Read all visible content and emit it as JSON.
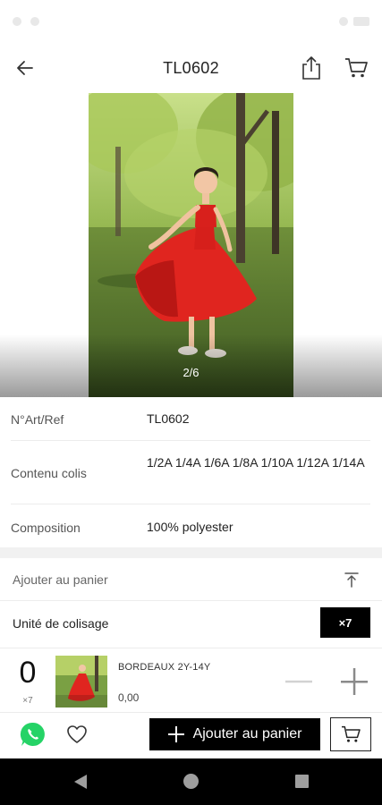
{
  "header": {
    "title": "TL0602"
  },
  "gallery": {
    "counter": "2/6"
  },
  "details": [
    {
      "label": "N°Art/Ref",
      "value": "TL0602"
    },
    {
      "label": "Contenu colis",
      "value": "1/2A 1/4A 1/6A 1/8A 1/10A 1/12A 1/14A"
    },
    {
      "label": "Composition",
      "value": "100% polyester"
    }
  ],
  "add_section": {
    "label": "Ajouter au panier"
  },
  "packing": {
    "label": "Unité de colisage",
    "badge": "×7"
  },
  "variant": {
    "quantity": "0",
    "multiplier": "×7",
    "name": "BORDEAUX 2Y-14Y",
    "price": "0,00"
  },
  "bottom_bar": {
    "add_to_cart_label": "Ajouter au panier"
  },
  "colors": {
    "accent": "#000000",
    "whatsapp": "#25D366",
    "dress_red": "#d8201c"
  },
  "icons": {
    "back": "arrow-left-icon",
    "share": "share-icon",
    "cart": "cart-icon",
    "collapse": "collapse-top-icon",
    "minus": "minus-icon",
    "plus": "plus-icon",
    "whatsapp": "whatsapp-icon",
    "favorite": "heart-icon"
  }
}
